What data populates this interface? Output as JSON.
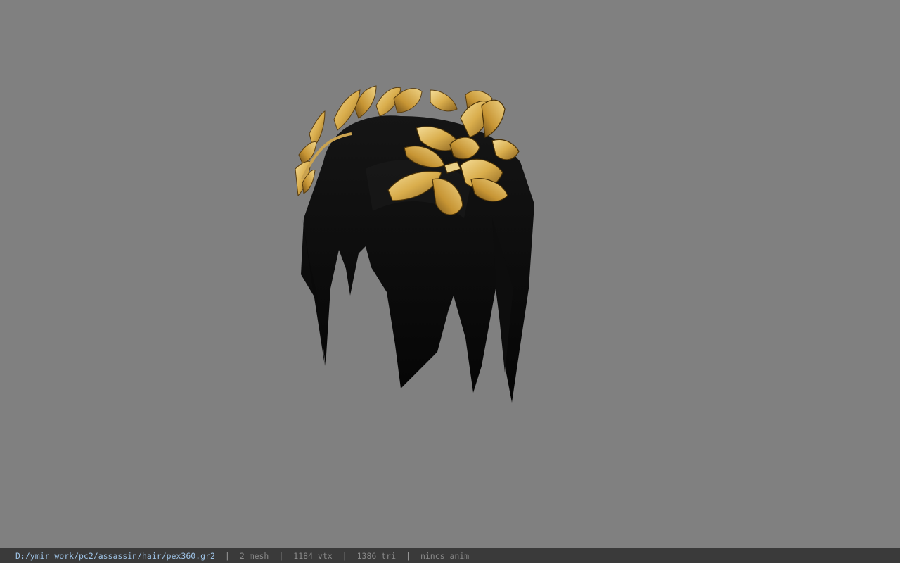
{
  "viewer": {
    "background_color": "#808080",
    "model_icon": "hair-with-laurel-crown-icon"
  },
  "status": {
    "file_path": "D:/ymir work/pc2/assassin/hair/pex360.gr2",
    "separator": "|",
    "mesh": "2 mesh",
    "vtx": "1184 vtx",
    "tri": "1386 tri",
    "anim": "nincs anim"
  }
}
